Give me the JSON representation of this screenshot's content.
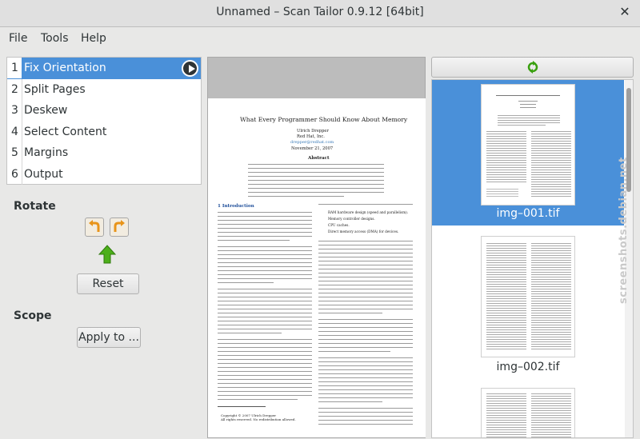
{
  "window": {
    "title": "Unnamed – Scan Tailor 0.9.12 [64bit]"
  },
  "menu": [
    "File",
    "Tools",
    "Help"
  ],
  "stages": [
    {
      "num": "1",
      "label": "Fix Orientation"
    },
    {
      "num": "2",
      "label": "Split Pages"
    },
    {
      "num": "3",
      "label": "Deskew"
    },
    {
      "num": "4",
      "label": "Select Content"
    },
    {
      "num": "5",
      "label": "Margins"
    },
    {
      "num": "6",
      "label": "Output"
    }
  ],
  "options": {
    "rotate_heading": "Rotate",
    "reset_label": "Reset",
    "scope_heading": "Scope",
    "apply_label": "Apply to ..."
  },
  "document": {
    "title": "What Every Programmer Should Know About Memory",
    "author": "Ulrich Drepper",
    "company": "Red Hat, Inc.",
    "email": "drepper@redhat.com",
    "date": "November 21, 2007",
    "abstract_heading": "Abstract",
    "section_heading": "1   Introduction",
    "bullets": [
      "RAM hardware design (speed and parallelism).",
      "Memory controller designs.",
      "CPU caches.",
      "Direct memory access (DMA) for devices."
    ],
    "copyright_1": "Copyright © 2007 Ulrich Drepper",
    "copyright_2": "All rights reserved. No redistribution allowed."
  },
  "thumbnails": [
    {
      "label": "img–001.tif",
      "selected": true
    },
    {
      "label": "img–002.tif",
      "selected": false
    }
  ],
  "watermark": "screenshots.debian.net",
  "colors": {
    "selection": "#4a90d9",
    "rotate_arrow": "#f0a020",
    "up_arrow": "#4caf1a"
  }
}
